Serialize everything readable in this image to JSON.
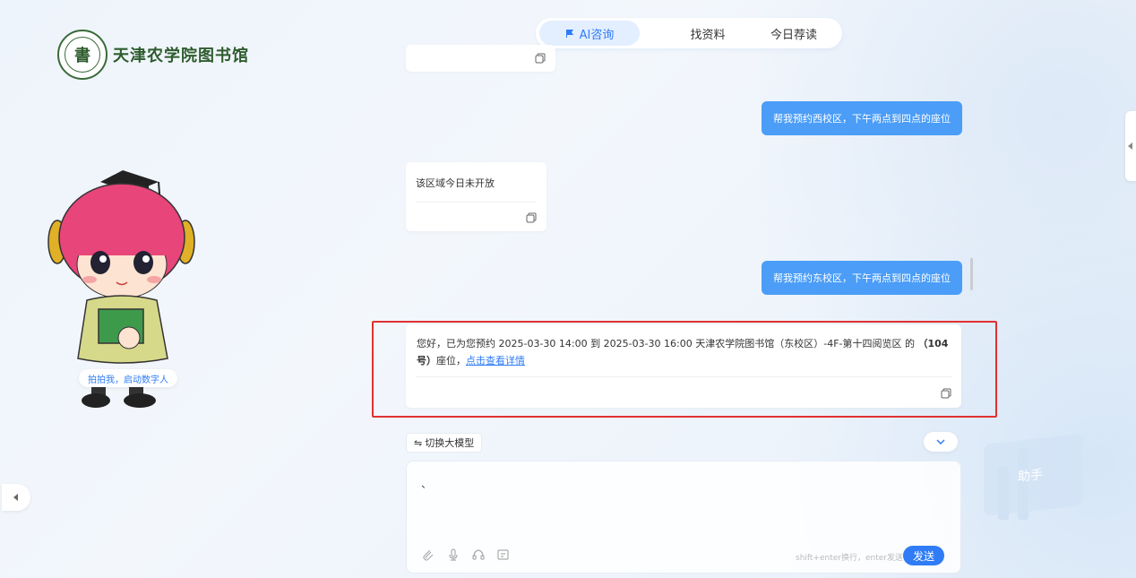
{
  "library": {
    "name": "天津农学院图书馆",
    "seal_char": "書"
  },
  "tabs": [
    {
      "label": "AI咨询",
      "active": true
    },
    {
      "label": "找资料",
      "active": false
    },
    {
      "label": "今日荐读",
      "active": false
    }
  ],
  "messages": {
    "user1": "帮我预约西校区，下午两点到四点的座位",
    "bot1": "该区域今日未开放",
    "user2": "帮我预约东校区，下午两点到四点的座位",
    "bot2": {
      "prefix": "您好，已为您预约 2025-03-30 14:00 到 2025-03-30 16:00 天津农学院图书馆（东校区）-4F-第十四阅览区 的",
      "seat": "（104号）",
      "suffix": "座位，",
      "link": "点击查看详情"
    }
  },
  "model_switch": {
    "icon": "⇋",
    "label": "切换大模型"
  },
  "input": {
    "value": "、",
    "hint": "shift+enter换行，enter发送",
    "send_label": "发送"
  },
  "mascot": {
    "badge": "拍拍我，启动数字人"
  },
  "bg": {
    "label": "助手"
  },
  "colors": {
    "accent": "#2f7cf6",
    "user_bubble": "#4b9df7",
    "highlight": "#e03131",
    "logo_green": "#2e5c2e"
  }
}
